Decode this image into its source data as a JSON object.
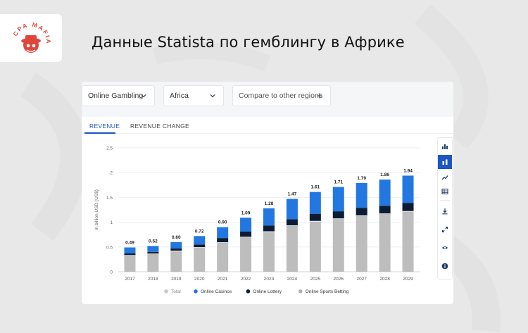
{
  "header": {
    "title": "Данные Statista по гемблингу в Африке",
    "logo_text": "CPA MAFIA"
  },
  "filters": {
    "market_select": "Online Gambling",
    "region_select": "Africa",
    "compare_button": "Compare to other regions"
  },
  "tabs": [
    {
      "label": "REVENUE",
      "active": true
    },
    {
      "label": "REVENUE CHANGE",
      "active": false
    }
  ],
  "toolbar_icons": [
    "bar-chart-icon",
    "stacked-bar-icon",
    "line-chart-icon",
    "table-icon",
    "download-icon",
    "expand-icon",
    "eye-icon",
    "info-icon"
  ],
  "chart_data": {
    "type": "bar",
    "stacked": true,
    "ylabel": "in billion USD (US$)",
    "ylim": [
      0,
      2.5
    ],
    "yticks": [
      "0",
      "0.5",
      "1",
      "1.5",
      "2",
      "2.5"
    ],
    "categories": [
      "2017",
      "2018",
      "2019",
      "2020",
      "2021",
      "2022",
      "2023",
      "2024",
      "2025",
      "2026",
      "2027",
      "2028",
      "2029"
    ],
    "totals": [
      "0.49",
      "0.52",
      "0.60",
      "0.72",
      "0.90",
      "1.09",
      "1.28",
      "1.47",
      "1.61",
      "1.71",
      "1.79",
      "1.86",
      "1.94"
    ],
    "series": [
      {
        "name": "Online Sports Betting",
        "color": "#bdbdbd",
        "values": [
          0.33,
          0.36,
          0.42,
          0.49,
          0.59,
          0.7,
          0.81,
          0.93,
          1.02,
          1.07,
          1.13,
          1.17,
          1.22
        ]
      },
      {
        "name": "Online Lottery",
        "color": "#0c1c33",
        "values": [
          0.04,
          0.04,
          0.05,
          0.06,
          0.09,
          0.11,
          0.12,
          0.13,
          0.15,
          0.15,
          0.16,
          0.16,
          0.17
        ]
      },
      {
        "name": "Online Casinos",
        "color": "#2277e0",
        "values": [
          0.12,
          0.12,
          0.13,
          0.17,
          0.22,
          0.28,
          0.35,
          0.41,
          0.44,
          0.49,
          0.5,
          0.53,
          0.55
        ]
      }
    ],
    "legend": [
      {
        "name": "Total",
        "color": "#c8c8c8"
      },
      {
        "name": "Online Casinos",
        "color": "#2277e0"
      },
      {
        "name": "Online Lottery",
        "color": "#0c1c33"
      },
      {
        "name": "Online Sports Betting",
        "color": "#b0b0b0"
      }
    ],
    "legend_position": "bottom",
    "grid": true
  }
}
